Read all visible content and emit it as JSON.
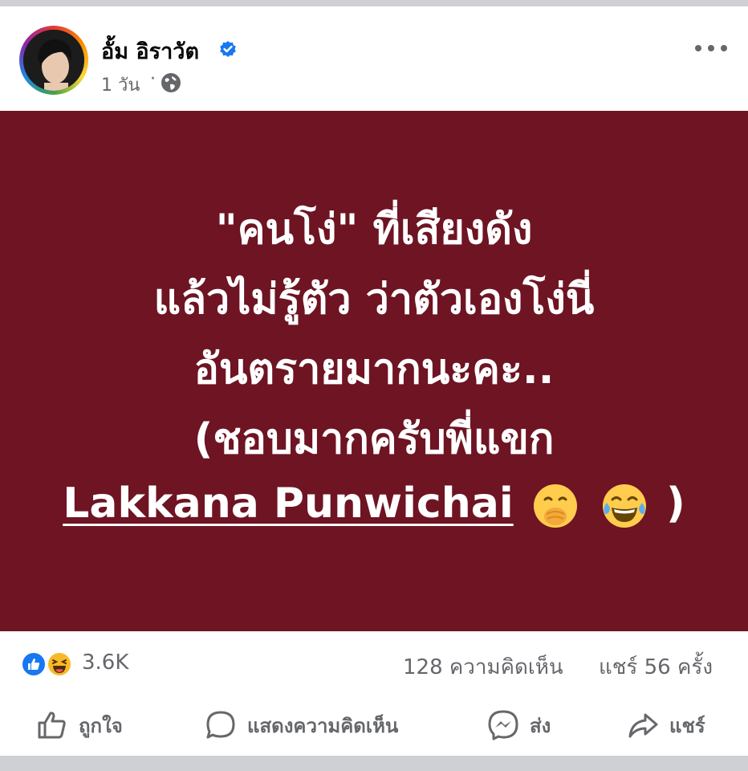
{
  "post": {
    "author": "อั้ม อิราวัต",
    "time": "1 วัน",
    "separator": "·",
    "verified": true,
    "content_bg_color": "#6e1423",
    "lines": [
      "\"คนโง่\" ที่เสียงดัง",
      "แล้วไม่รู้ตัว ว่าตัวเองโง่นี่",
      "อันตรายมากนะคะ..",
      "(ชอบมากครับพี่แขก"
    ],
    "mention": "Lakkana Punwichai",
    "last_line_suffix": ")",
    "emojis": [
      "hand-over-mouth-emoji",
      "tears-of-joy-emoji"
    ]
  },
  "stats": {
    "reactions_count": "3.6K",
    "reaction_icons": [
      "like-reaction-icon",
      "haha-reaction-icon"
    ],
    "comments": "128 ความคิดเห็น",
    "shares": "แชร์ 56 ครั้ง"
  },
  "actions": {
    "like": "ถูกใจ",
    "comment": "แสดงความคิดเห็น",
    "send": "ส่ง",
    "share": "แชร์"
  },
  "colors": {
    "facebook_blue": "#1877f2",
    "secondary_text": "#65676b"
  }
}
